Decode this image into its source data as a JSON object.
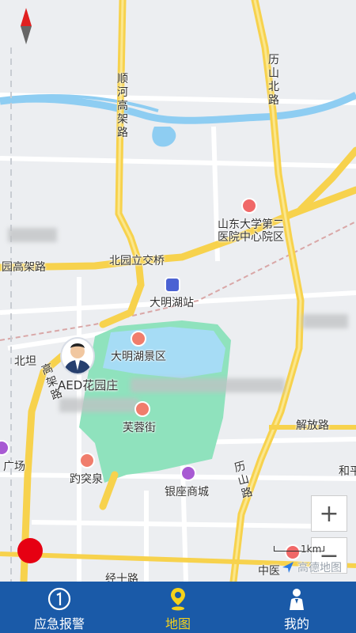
{
  "map": {
    "road_labels": {
      "shunhe": "顺河高架路",
      "lishan_north": "历山北路",
      "gaojia_left": "园高架路",
      "beiyuan_bridge": "北园立交桥",
      "daminghu_station": "大明湖站",
      "beitan": "北坦",
      "gaojia_vertical": "高架路",
      "jiefang": "解放路",
      "lishan": "历山路",
      "guangchang": "广场",
      "he": "和平",
      "jingshi": "经十路",
      "zhongyi": "中医"
    },
    "poi_labels": {
      "hospital": "山东大学第二医院中心院区",
      "daminghu_scenic": "大明湖景区",
      "aed": "AED花园庄",
      "furongjie": "芙蓉街",
      "baotuquan": "趵突泉",
      "yinzuo": "银座商城"
    },
    "scale": "1km",
    "watermark": "高德地图"
  },
  "controls": {
    "zoom_in": "+",
    "zoom_out": "−"
  },
  "tabs": [
    {
      "label": "应急报警",
      "icon": "alarm-icon",
      "active": false
    },
    {
      "label": "地图",
      "icon": "location-pin-icon",
      "active": true
    },
    {
      "label": "我的",
      "icon": "person-icon",
      "active": false
    }
  ],
  "colors": {
    "tabbar": "#1a5aa8",
    "active_tab": "#f5d21b",
    "park": "#8fe2bd",
    "water": "#8ecdf2",
    "highway": "#f7d24d",
    "alert_dot": "#e60012"
  }
}
